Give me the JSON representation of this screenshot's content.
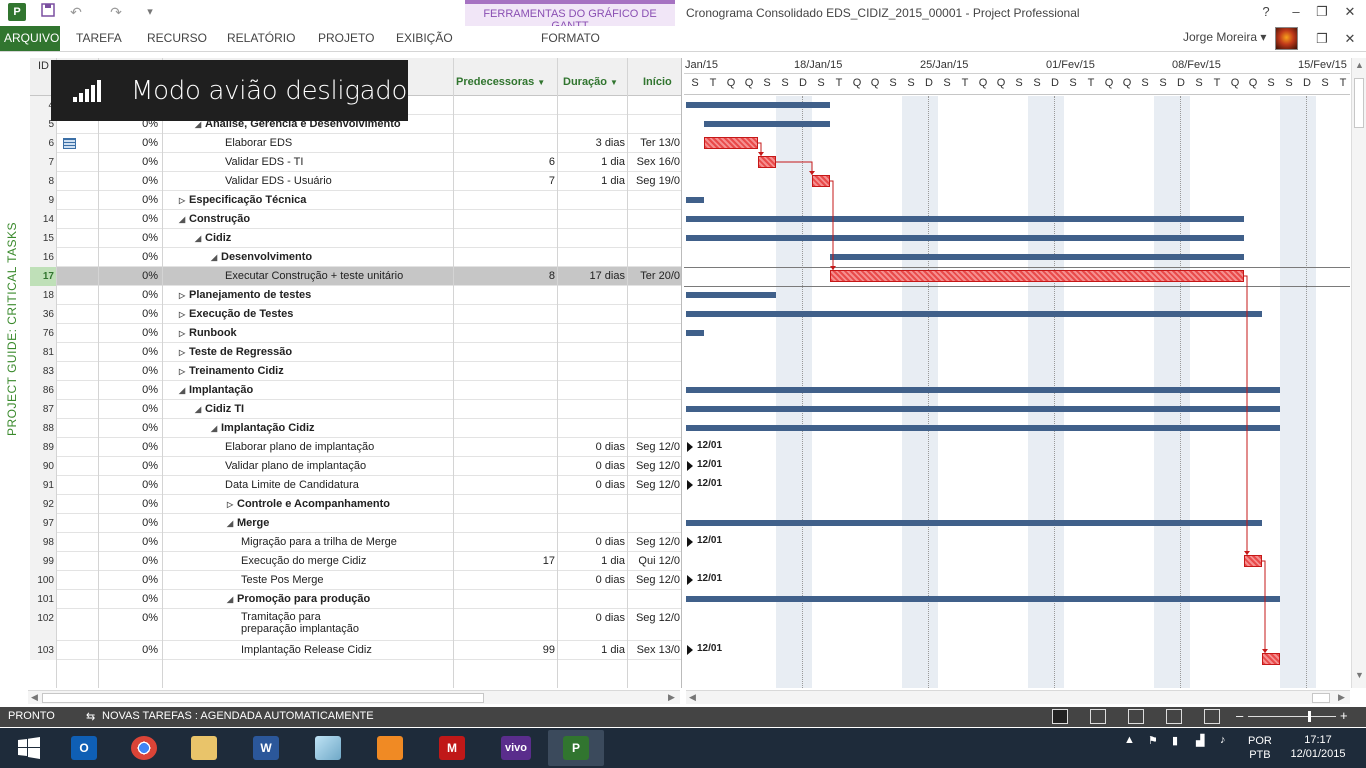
{
  "title_bar": {
    "app_icon_letter": "P",
    "contextual_group": "FERRAMENTAS DO GRÁFICO DE GANTT",
    "window_title": "Cronograma Consolidado EDS_CIDIZ_2015_00001 - Project Professional",
    "help": "?",
    "minimize": "–",
    "restore": "❐",
    "close": "✕",
    "restore_ribbon": "❐"
  },
  "ribbon": {
    "tabs": [
      "ARQUIVO",
      "TAREFA",
      "RECURSO",
      "RELATÓRIO",
      "PROJETO",
      "EXIBIÇÃO",
      "FORMATO"
    ],
    "user": "Jorge Moreira",
    "user_caret": "▾",
    "close_tab": "✕"
  },
  "side_label": "PROJECT GUIDE: CRITICAL TASKS",
  "toast": {
    "text": "Modo avião desligado"
  },
  "grid": {
    "headers": {
      "id": "ID",
      "predecessors": "Predecessoras",
      "duration": "Duração",
      "start": "Início",
      "sort_arrow": "▼"
    },
    "rows": [
      {
        "id": "4",
        "pct": "",
        "name": "",
        "bold": true,
        "indent": 0,
        "toggle": "",
        "pred": "",
        "dur": "",
        "start": ""
      },
      {
        "id": "5",
        "pct": "0%",
        "name": "Análise, Gerência e Desenvolvimento",
        "bold": true,
        "indent": 2,
        "toggle": "◢",
        "pred": "",
        "dur": "",
        "start": ""
      },
      {
        "id": "6",
        "pct": "0%",
        "name": "Elaborar EDS",
        "bold": false,
        "indent": 3,
        "toggle": "",
        "pred": "",
        "dur": "3 dias",
        "start": "Ter 13/0",
        "indicator": "calendar-icon"
      },
      {
        "id": "7",
        "pct": "0%",
        "name": "Validar EDS - TI",
        "bold": false,
        "indent": 3,
        "toggle": "",
        "pred": "6",
        "dur": "1 dia",
        "start": "Sex 16/0"
      },
      {
        "id": "8",
        "pct": "0%",
        "name": "Validar EDS - Usuário",
        "bold": false,
        "indent": 3,
        "toggle": "",
        "pred": "7",
        "dur": "1 dia",
        "start": "Seg 19/0"
      },
      {
        "id": "9",
        "pct": "0%",
        "name": "Especificação Técnica",
        "bold": true,
        "indent": 1,
        "toggle": "▷",
        "pred": "",
        "dur": "",
        "start": ""
      },
      {
        "id": "14",
        "pct": "0%",
        "name": "Construção",
        "bold": true,
        "indent": 1,
        "toggle": "◢",
        "pred": "",
        "dur": "",
        "start": ""
      },
      {
        "id": "15",
        "pct": "0%",
        "name": "Cidiz",
        "bold": true,
        "indent": 2,
        "toggle": "◢",
        "pred": "",
        "dur": "",
        "start": ""
      },
      {
        "id": "16",
        "pct": "0%",
        "name": "Desenvolvimento",
        "bold": true,
        "indent": 3,
        "toggle": "◢",
        "pred": "",
        "dur": "",
        "start": ""
      },
      {
        "id": "17",
        "pct": "0%",
        "name": "Executar Construção + teste unitário",
        "bold": false,
        "indent": 3,
        "toggle": "",
        "pred": "8",
        "dur": "17 dias",
        "start": "Ter 20/0",
        "selected": true
      },
      {
        "id": "18",
        "pct": "0%",
        "name": "Planejamento de testes",
        "bold": true,
        "indent": 1,
        "toggle": "▷",
        "pred": "",
        "dur": "",
        "start": ""
      },
      {
        "id": "36",
        "pct": "0%",
        "name": "Execução de Testes",
        "bold": true,
        "indent": 1,
        "toggle": "▷",
        "pred": "",
        "dur": "",
        "start": ""
      },
      {
        "id": "76",
        "pct": "0%",
        "name": "Runbook",
        "bold": true,
        "indent": 1,
        "toggle": "▷",
        "pred": "",
        "dur": "",
        "start": ""
      },
      {
        "id": "81",
        "pct": "0%",
        "name": "Teste de Regressão",
        "bold": true,
        "indent": 1,
        "toggle": "▷",
        "pred": "",
        "dur": "",
        "start": ""
      },
      {
        "id": "83",
        "pct": "0%",
        "name": "Treinamento Cidiz",
        "bold": true,
        "indent": 1,
        "toggle": "▷",
        "pred": "",
        "dur": "",
        "start": ""
      },
      {
        "id": "86",
        "pct": "0%",
        "name": "Implantação",
        "bold": true,
        "indent": 1,
        "toggle": "◢",
        "pred": "",
        "dur": "",
        "start": ""
      },
      {
        "id": "87",
        "pct": "0%",
        "name": "Cidiz TI",
        "bold": true,
        "indent": 2,
        "toggle": "◢",
        "pred": "",
        "dur": "",
        "start": ""
      },
      {
        "id": "88",
        "pct": "0%",
        "name": "Implantação Cidiz",
        "bold": true,
        "indent": 3,
        "toggle": "◢",
        "pred": "",
        "dur": "",
        "start": ""
      },
      {
        "id": "89",
        "pct": "0%",
        "name": "Elaborar plano de implantação",
        "bold": false,
        "indent": 3,
        "toggle": "",
        "pred": "",
        "dur": "0 dias",
        "start": "Seg 12/0"
      },
      {
        "id": "90",
        "pct": "0%",
        "name": "Validar plano de implantação",
        "bold": false,
        "indent": 3,
        "toggle": "",
        "pred": "",
        "dur": "0 dias",
        "start": "Seg 12/0"
      },
      {
        "id": "91",
        "pct": "0%",
        "name": "Data Limite de Candidatura",
        "bold": false,
        "indent": 3,
        "toggle": "",
        "pred": "",
        "dur": "0 dias",
        "start": "Seg 12/0"
      },
      {
        "id": "92",
        "pct": "0%",
        "name": "Controle e Acompanhamento",
        "bold": true,
        "indent": 4,
        "toggle": "▷",
        "pred": "",
        "dur": "",
        "start": ""
      },
      {
        "id": "97",
        "pct": "0%",
        "name": "Merge",
        "bold": true,
        "indent": 4,
        "toggle": "◢",
        "pred": "",
        "dur": "",
        "start": ""
      },
      {
        "id": "98",
        "pct": "0%",
        "name": "Migração para a trilha de Merge",
        "bold": false,
        "indent": 4,
        "toggle": "",
        "pred": "",
        "dur": "0 dias",
        "start": "Seg 12/0"
      },
      {
        "id": "99",
        "pct": "0%",
        "name": "Execução do merge Cidiz",
        "bold": false,
        "indent": 4,
        "toggle": "",
        "pred": "17",
        "dur": "1 dia",
        "start": "Qui 12/0"
      },
      {
        "id": "100",
        "pct": "0%",
        "name": "Teste Pos Merge",
        "bold": false,
        "indent": 4,
        "toggle": "",
        "pred": "",
        "dur": "0 dias",
        "start": "Seg 12/0"
      },
      {
        "id": "101",
        "pct": "0%",
        "name": "Promoção para produção",
        "bold": true,
        "indent": 4,
        "toggle": "◢",
        "pred": "",
        "dur": "",
        "start": ""
      },
      {
        "id": "102",
        "pct": "0%",
        "name": "Tramitação para preparação implantação",
        "bold": false,
        "indent": 4,
        "toggle": "",
        "pred": "",
        "dur": "0 dias",
        "start": "Seg 12/0",
        "tall": true
      },
      {
        "id": "103",
        "pct": "0%",
        "name": "Implantação Release Cidiz",
        "bold": false,
        "indent": 4,
        "toggle": "",
        "pred": "99",
        "dur": "1 dia",
        "start": "Sex 13/0"
      }
    ]
  },
  "gantt": {
    "weeks": [
      "Jan/15",
      "18/Jan/15",
      "25/Jan/15",
      "01/Fev/15",
      "08/Fev/15",
      "15/Fev/15"
    ],
    "day_letters": [
      "S",
      "T",
      "Q",
      "Q",
      "S",
      "S",
      "D",
      "S",
      "T",
      "Q",
      "Q",
      "S",
      "S",
      "D",
      "S",
      "T",
      "Q",
      "Q",
      "S",
      "S",
      "D",
      "S",
      "T",
      "Q",
      "Q",
      "S",
      "S",
      "D",
      "S",
      "T",
      "Q",
      "Q",
      "S",
      "S",
      "D",
      "S",
      "T"
    ],
    "milestone_label": "12/01"
  },
  "status_bar": {
    "ready": "PRONTO",
    "new_tasks": "NOVAS TAREFAS : AGENDADA AUTOMATICAMENTE",
    "zoom_minus": "–",
    "zoom_plus": "+"
  },
  "taskbar": {
    "apps": [
      "start",
      "outlook",
      "chrome",
      "explorer",
      "word",
      "notepad",
      "orange-app",
      "mcafee",
      "vivo",
      "project"
    ],
    "word_letter": "W",
    "outlook_letter": "O",
    "project_letter": "P",
    "vivo_label": "vivo",
    "mcafee_letter": "M",
    "language_top": "POR",
    "language_bottom": "PTB",
    "time": "17:17",
    "date": "12/01/2015"
  },
  "colors": {
    "accent": "#31752f",
    "contextual": "#a672c2",
    "summary_bar": "#40608a",
    "critical_bar": "#e94a4a",
    "taskbar": "#1e2b3a"
  }
}
